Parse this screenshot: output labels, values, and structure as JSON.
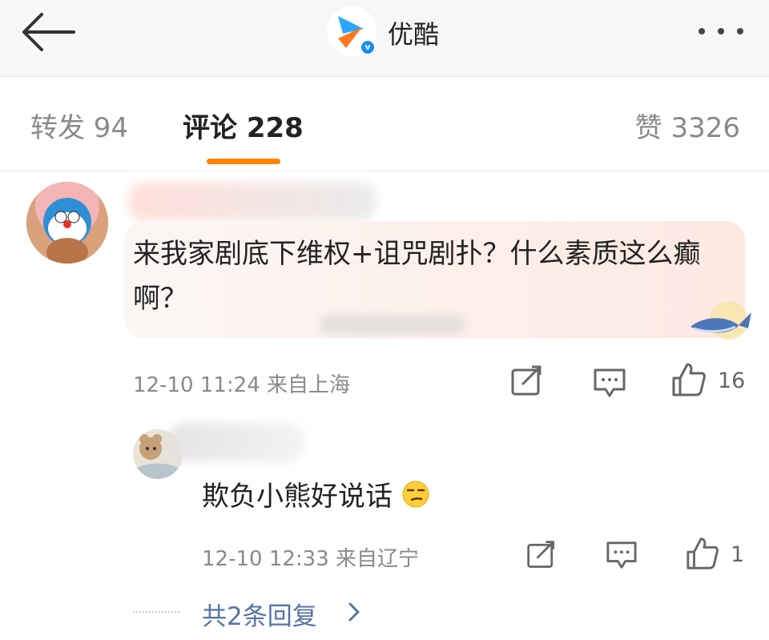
{
  "header": {
    "app_name": "优酷",
    "logo_icon": "youku-logo-icon",
    "verified_icon": "verified-badge-icon"
  },
  "tabs": {
    "repost": "转发 94",
    "comments": "评论 228",
    "likes": "赞 3326",
    "active": "comments",
    "accent_color": "#ff8200"
  },
  "comments": [
    {
      "text": "来我家剧底下维权+诅咒剧扑？什么素质这么癫啊？",
      "timestamp": "12-10 11:24",
      "location": "来自上海",
      "like_count": "16"
    }
  ],
  "reply": {
    "text": "欺负小熊好说话",
    "emoji": "smirk-face-emoji",
    "timestamp": "12-10 12:33",
    "location": "来自辽宁",
    "like_count": "1"
  },
  "replies_link": {
    "label": "共2条回复",
    "link_color": "#5673a6"
  }
}
